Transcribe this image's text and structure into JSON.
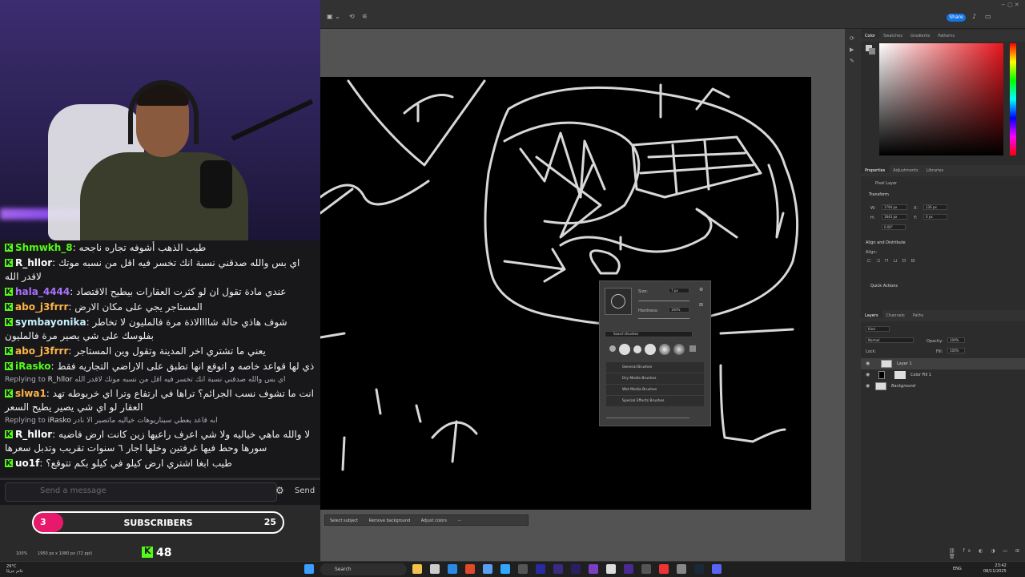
{
  "chat": {
    "messages": [
      {
        "user": "Shmwkh_8",
        "color": "#53fc18",
        "text": "طيب الذهب أشوفه تجاره ناجحه"
      },
      {
        "user": "R_hllor",
        "color": "#ffffff",
        "text": "اي بس والله صدقني نسبة انك تخسر فيه اقل من نسبه موتك لاقدر الله"
      },
      {
        "user": "hala_4444",
        "color": "#a970ff",
        "text": "عندي مادة تقول ان لو كثرت العقارات بيطيح الاقتصاد"
      },
      {
        "user": "abo_j3frrr",
        "color": "#ffb347",
        "text": "المستاجر يجي على مكان الارض"
      },
      {
        "user": "symbayonika",
        "color": "#c6f0ff",
        "text": "شوف هاذي حالة شاااالاذة مرة فالمليون لا تخاطر بفلوسك على شي يصير مرة فالمليون"
      },
      {
        "user": "abo_j3frrr",
        "color": "#ffb347",
        "text": "يعني ما تشتري اخر المدينة وتقول وين المستاجر"
      },
      {
        "user": "iRasko",
        "color": "#53fc18",
        "text": "ذي لها قواعد خاصه و اتوقع انها تطبق على الاراضي التجاريه فقط"
      },
      {
        "reply_to": "R_hllor",
        "reply_text": "اي بس والله صدقني نسبة انك تخسر فيه اقل من نسبه موتك لاقدر الله",
        "user": "slwa1",
        "color": "#ffb347",
        "text": "انت ما تشوف نسب الجرائم؟ تراها في ارتفاع وترا اي خربوطه تهد العقار لو اي شي يصير يطيح السعر"
      },
      {
        "reply_to": "iRasko",
        "reply_text": "ابه قاعد يعطي سيناريوهات خياليه ماتصير الا نادر",
        "user": "R_hllor",
        "color": "#ffffff",
        "text": "لا والله ماهي خياليه ولا شي اعرف راعيها زين كانت ارض فاضيه سورها وحط فيها غرفتين وخلها اجار ٦ سنوات تقريب وتدبل سعرها"
      },
      {
        "user": "uo1f",
        "color": "#ffffff",
        "text": "طيب ابغا اشتري ارض كيلو في كيلو بكم تتوقع؟"
      }
    ],
    "replying_label": "Replying to",
    "input_placeholder": "Send a message",
    "send_label": "Send"
  },
  "subs": {
    "current": "3",
    "label": "SUBSCRIBERS",
    "goal": "25",
    "progress": 0.12
  },
  "kick_count": "48",
  "photoshop": {
    "share_label": "Share",
    "color_tabs": [
      "Color",
      "Swatches",
      "Gradients",
      "Patterns"
    ],
    "prop_tabs": [
      "Properties",
      "Adjustments",
      "Libraries"
    ],
    "pixel_layer": "Pixel Layer",
    "transform_label": "Transform",
    "w": "1794 px",
    "h": "1843 px",
    "x": "136 px",
    "y": "0 px",
    "angle": "0.00°",
    "align_label": "Align and Distribute",
    "align_sub": "Align:",
    "quick_actions": "Quick Actions",
    "layer_tabs": [
      "Layers",
      "Channels",
      "Paths"
    ],
    "kind": "Kind",
    "blend": "Normal",
    "opacity_label": "Opacity:",
    "opacity": "100%",
    "lock_label": "Lock:",
    "fill_label": "Fill:",
    "fill": "100%",
    "layers": [
      "Layer 1",
      "Color Fill 1",
      "Background"
    ],
    "brush": {
      "size_label": "Size:",
      "size": "7 px",
      "hardness_label": "Hardness:",
      "hardness": "100%",
      "search": "Search Brushes",
      "groups": [
        "General Brushes",
        "Dry Media Brushes",
        "Wet Media Brushes",
        "Special Effects Brushes"
      ]
    },
    "context_bar": [
      "Select subject",
      "Remove background",
      "Adjust colors"
    ],
    "status": "1950 px x 1080 px (72 ppi)",
    "zoom": "100%"
  },
  "taskbar": {
    "search": "Search",
    "weather_temp": "29°C",
    "weather_desc": "غائم جزئيًا",
    "lang": "ENG",
    "time": "23:42",
    "date": "08/11/2025"
  }
}
